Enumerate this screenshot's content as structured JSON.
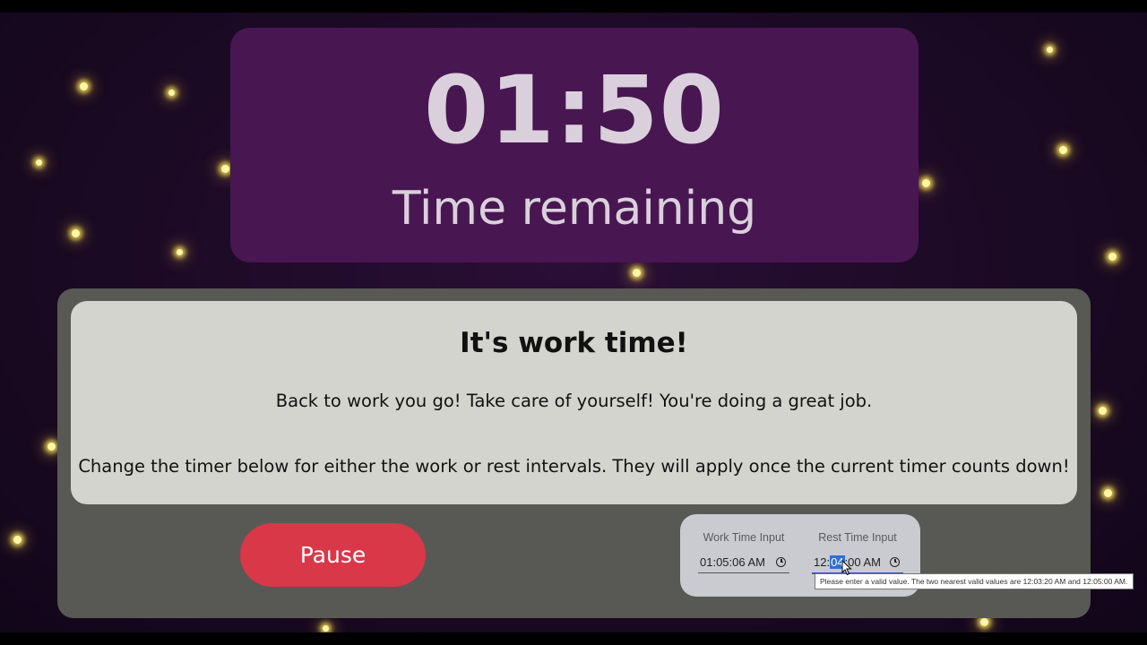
{
  "timer": {
    "digits": "01:50",
    "label": "Time remaining"
  },
  "message": {
    "title": "It's work time!",
    "line1": "Back to work you go! Take care of yourself! You're doing a great job.",
    "line2": "Change the timer below for either the work or rest intervals. They will apply once the current timer counts down!"
  },
  "controls": {
    "pause_label": "Pause"
  },
  "inputs": {
    "work": {
      "label": "Work Time Input",
      "value": "01:05:06 AM"
    },
    "rest": {
      "label": "Rest Time Input",
      "value_prefix": "12:",
      "value_selected": "04",
      "value_suffix": ":00 AM"
    }
  },
  "tooltip": {
    "text": "Please enter a valid value. The two nearest valid values are 12:03:20 AM and 12:05:00 AM."
  },
  "colors": {
    "timer_card": "#481651",
    "panel": "#585955",
    "message_box": "#d4d4cf",
    "pause_button": "#d83848",
    "inputs_card": "#c9cbd0",
    "firefly": "#fff6a8"
  }
}
